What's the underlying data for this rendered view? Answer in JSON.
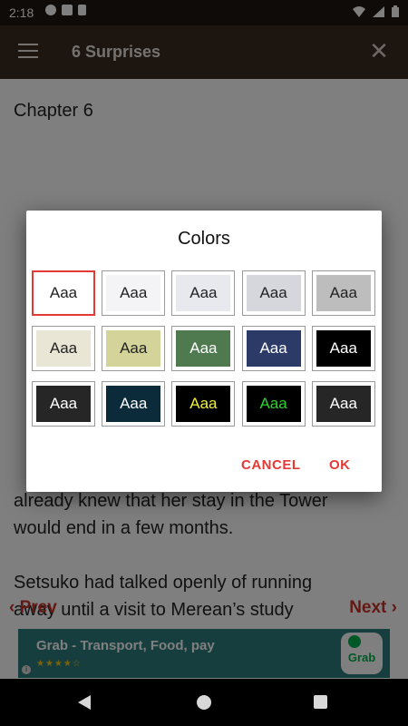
{
  "status_bar": {
    "time": "2:18"
  },
  "app_bar": {
    "title": "6 Surprises"
  },
  "content": {
    "chapter_title": "Chapter 6",
    "paragraphs": [
      "already knew that her stay in the Tower",
      "would end in a few months.",
      "",
      "Setsuko had talked openly of running",
      "away until a visit to Merean’s study"
    ],
    "prev_label": "Prev",
    "next_label": "Next"
  },
  "ad": {
    "title": "Grab - Transport, Food, pay",
    "stars": "★★★★☆",
    "logo_text": "Grab"
  },
  "dialog": {
    "title": "Colors",
    "swatches": [
      {
        "label": "Aaa",
        "bg": "#ffffff",
        "fg": "#222222",
        "selected": true
      },
      {
        "label": "Aaa",
        "bg": "#f4f4f6",
        "fg": "#222222"
      },
      {
        "label": "Aaa",
        "bg": "#e8e9ee",
        "fg": "#222222"
      },
      {
        "label": "Aaa",
        "bg": "#d6d7dc",
        "fg": "#222222"
      },
      {
        "label": "Aaa",
        "bg": "#bdbdbd",
        "fg": "#222222"
      },
      {
        "label": "Aaa",
        "bg": "#e9e6d6",
        "fg": "#222222"
      },
      {
        "label": "Aaa",
        "bg": "#d4d49a",
        "fg": "#222222"
      },
      {
        "label": "Aaa",
        "bg": "#4f7a4f",
        "fg": "#ffffff"
      },
      {
        "label": "Aaa",
        "bg": "#2b3a66",
        "fg": "#ffffff"
      },
      {
        "label": "Aaa",
        "bg": "#000000",
        "fg": "#ffffff"
      },
      {
        "label": "Aaa",
        "bg": "#262626",
        "fg": "#ffffff"
      },
      {
        "label": "Aaa",
        "bg": "#0b2b3a",
        "fg": "#ffffff"
      },
      {
        "label": "Aaa",
        "bg": "#000000",
        "fg": "#f2ef3a"
      },
      {
        "label": "Aaa",
        "bg": "#000000",
        "fg": "#2fd12f"
      },
      {
        "label": "Aaa",
        "bg": "#262626",
        "fg": "#ffffff"
      }
    ],
    "cancel_label": "CANCEL",
    "ok_label": "OK"
  }
}
